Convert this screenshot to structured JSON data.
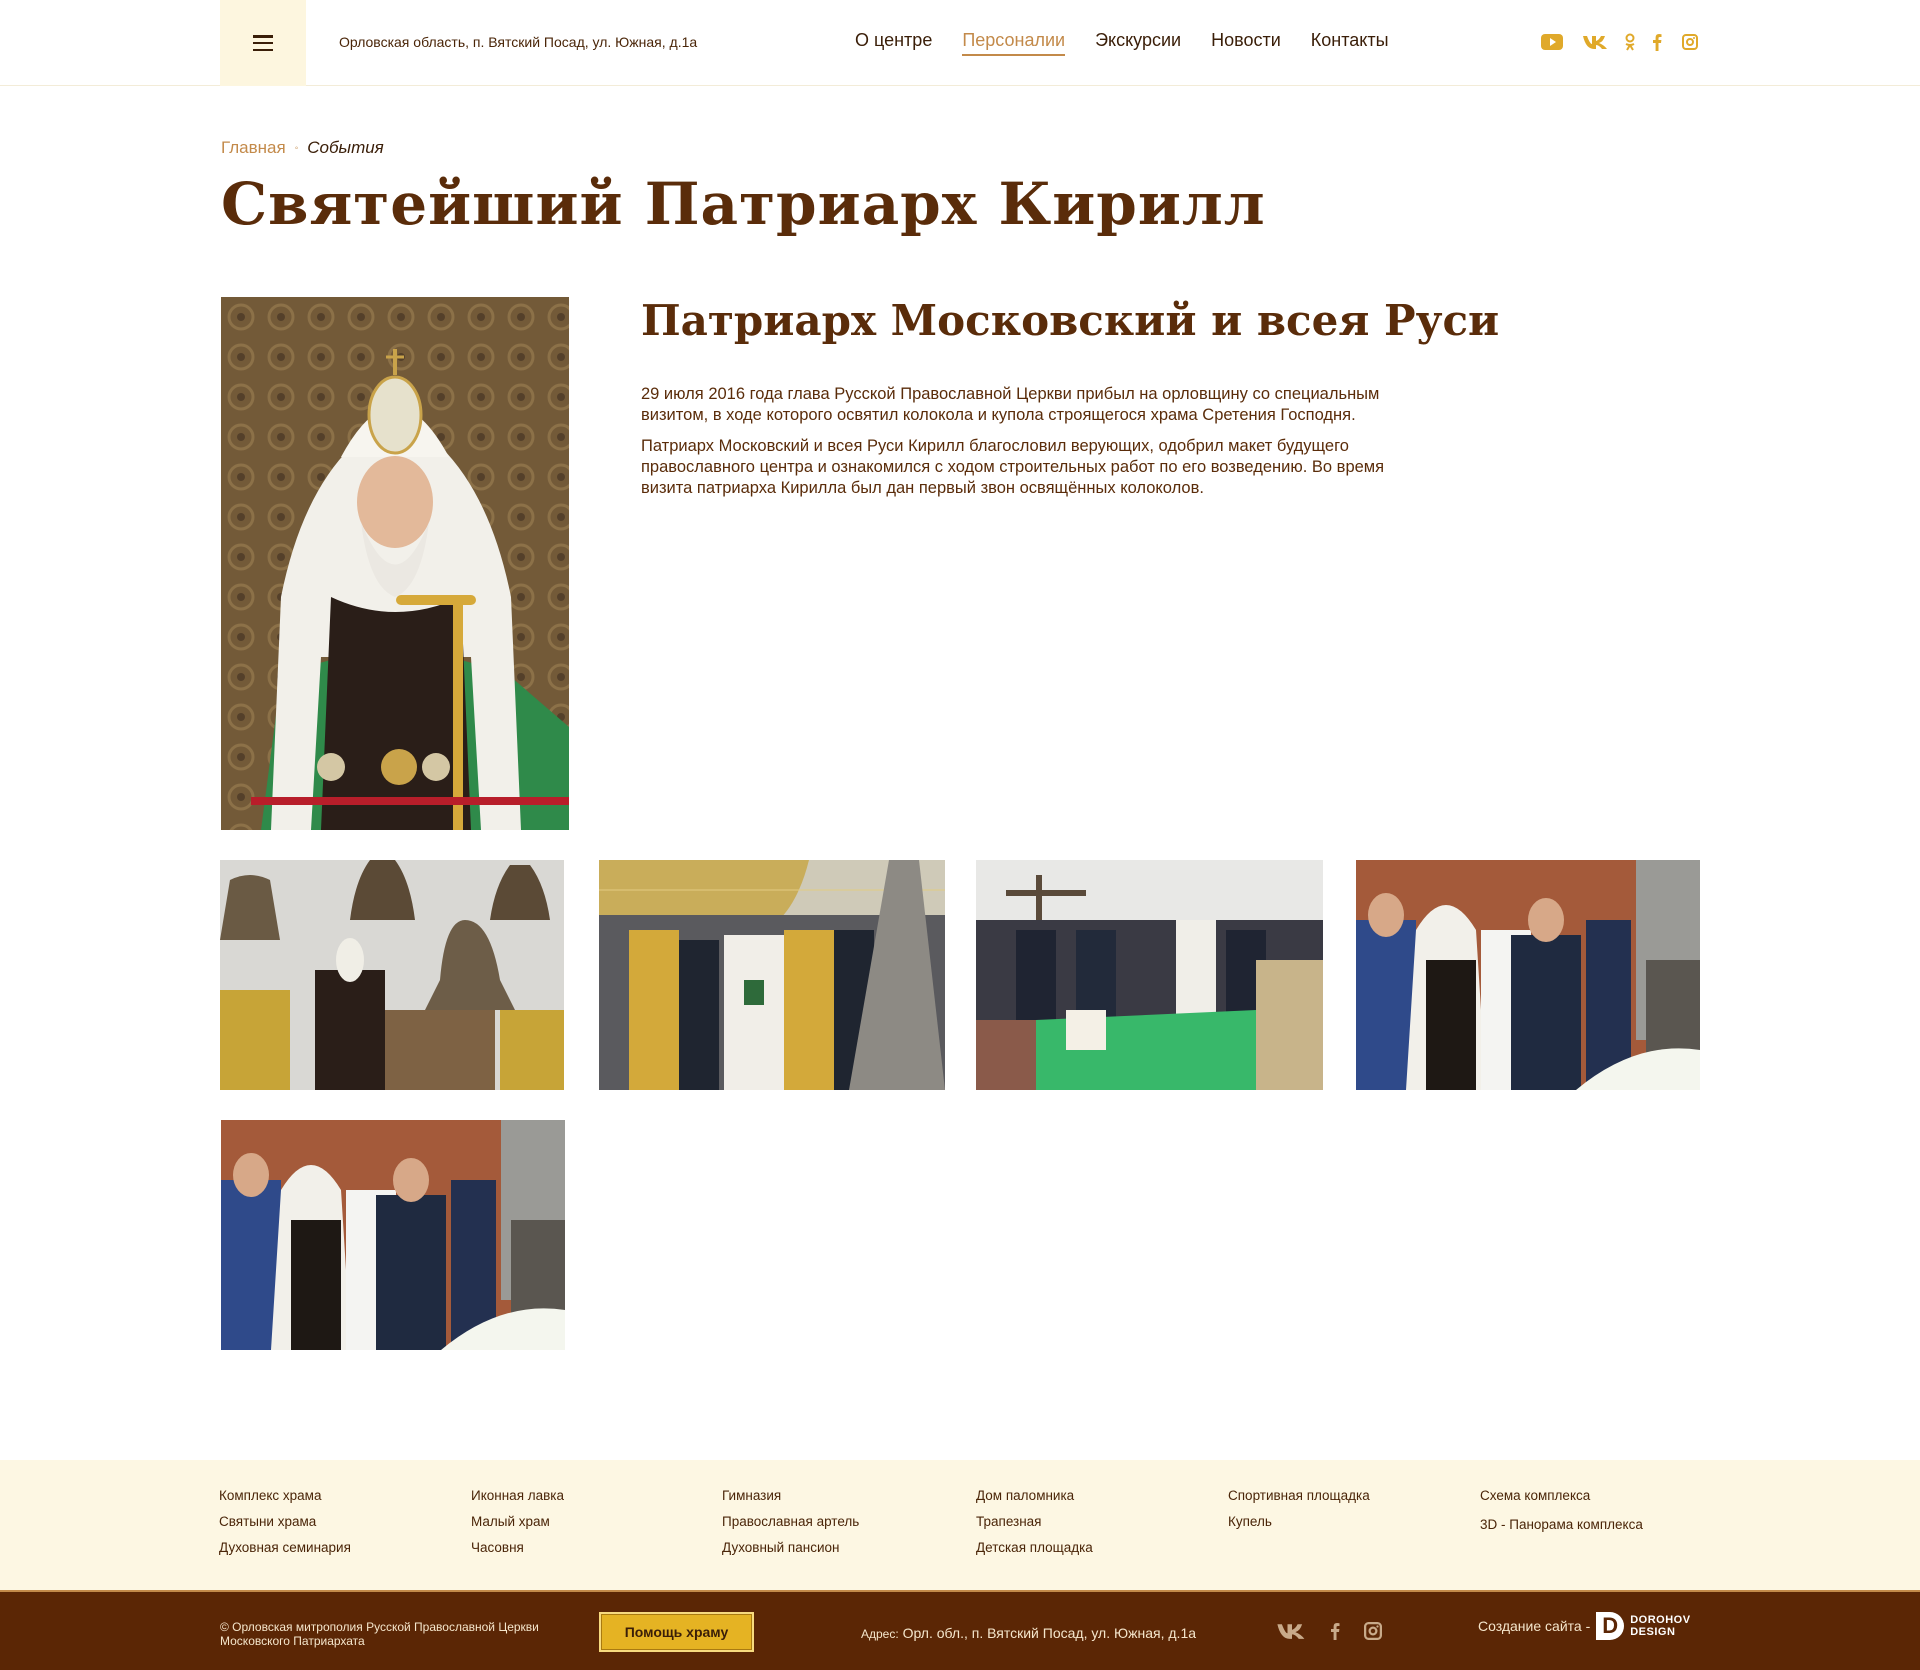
{
  "header": {
    "address": "Орловская область, п. Вятский Посад, ул. Южная, д.1а",
    "nav": [
      {
        "label": "О центре",
        "active": false
      },
      {
        "label": "Персоналии",
        "active": true
      },
      {
        "label": "Экскурсии",
        "active": false
      },
      {
        "label": "Новости",
        "active": false
      },
      {
        "label": "Контакты",
        "active": false
      }
    ],
    "social": [
      "youtube-icon",
      "vk-icon",
      "odnoklassniki-icon",
      "facebook-icon",
      "instagram-icon"
    ],
    "social_glyphs": [
      "▶",
      "VK",
      "ОК",
      "f",
      "◎"
    ]
  },
  "breadcrumb": {
    "home": "Главная",
    "separator": "◦",
    "current": "События"
  },
  "page_title": "Святейший Патриарх Кирилл",
  "content": {
    "subtitle": "Патриарх Московский и всея Руси",
    "paragraphs": [
      "29 июля 2016 года глава Русской Православной Церкви прибыл на орловщину со специальным визитом, в ходе которого освятил колокола и купола строящегося храма Сретения Господня.",
      "Патриарх Московский и всея Руси Кирилл благословил верующих, одобрил макет будущего православного центра и ознакомился с ходом строительных работ по его возведению. Во время визита патриарха Кирилла был дан первый звон освящённых колоколов."
    ]
  },
  "gallery": {
    "count": 5
  },
  "footer": {
    "columns": [
      [
        "Комплекс храма",
        "Святыни храма",
        "Духовная семинария"
      ],
      [
        "Иконная лавка",
        "Малый храм",
        "Часовня"
      ],
      [
        "Гимназия",
        "Православная артель",
        "Духовный пансион"
      ],
      [
        "Дом паломника",
        "Трапезная",
        "Детская площадка"
      ],
      [
        "Спортивная площадка",
        "Купель"
      ],
      [
        "Схема комплекса",
        "3D - Панорама комплекса"
      ]
    ]
  },
  "bottom": {
    "copyright": "© Орловская митрополия Русской Православной Церкви Московского Патриархата",
    "donate_label": "Помощь храму",
    "address_label": "Адрес:",
    "address": "Орл. обл.,  п. Вятский Посад, ул. Южная, д.1а",
    "social": [
      "vk-icon",
      "facebook-icon",
      "instagram-icon"
    ],
    "social_glyphs": [
      "VK",
      "f",
      "◎"
    ],
    "credit_text": "Создание сайта -",
    "credit_logo": "D",
    "credit_brand_1": "DOROHOV",
    "credit_brand_2": "DESIGN"
  },
  "colors": {
    "brown": "#5a2c0a",
    "accent": "#c38a4a",
    "gold": "#e5b323",
    "cream": "#fdf7e3",
    "footer_bg": "#5b2605"
  }
}
